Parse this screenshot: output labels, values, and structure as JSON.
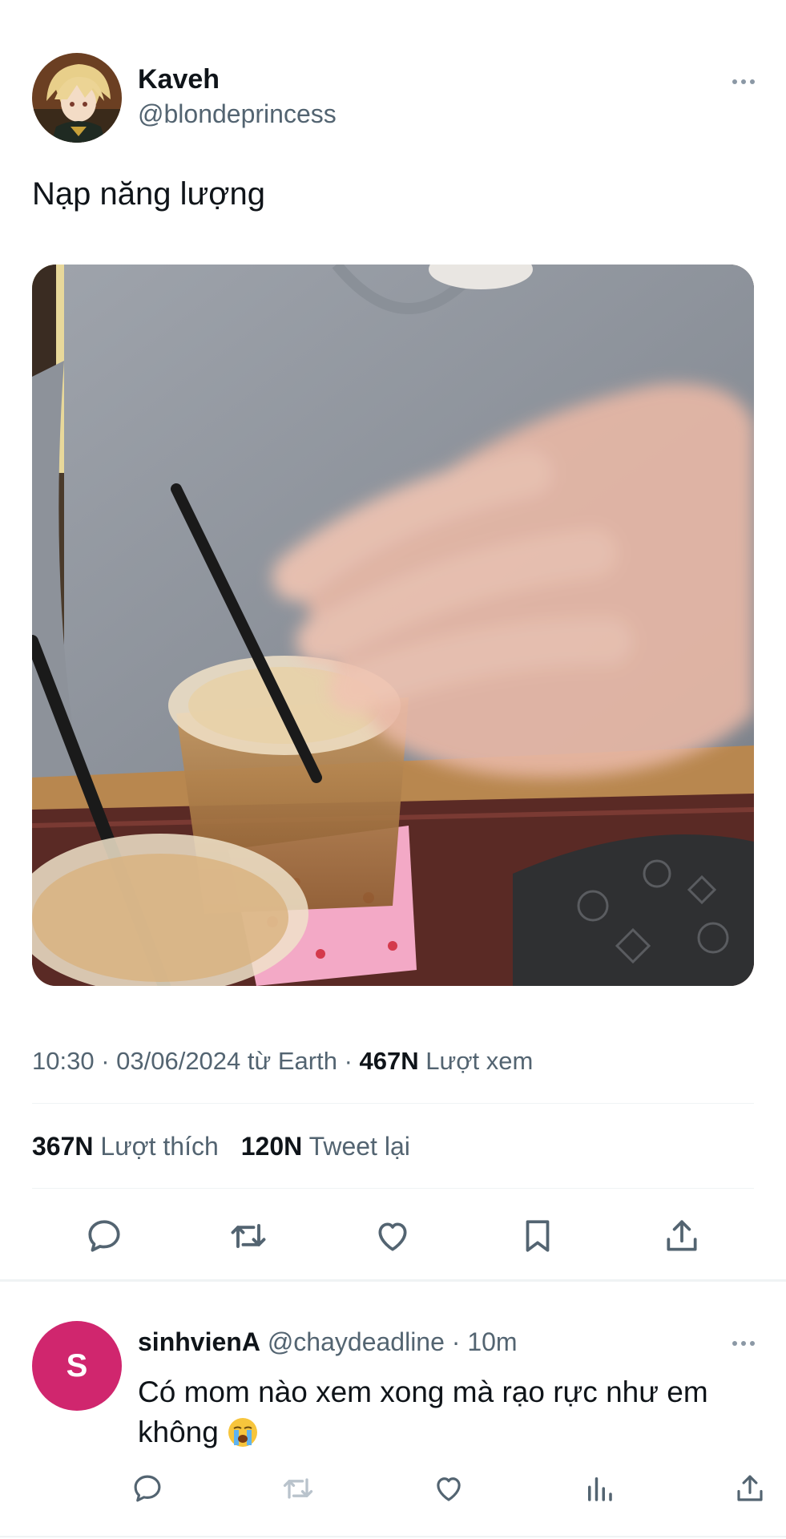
{
  "post": {
    "author_name": "Kaveh",
    "author_handle": "@blondeprincess",
    "text": "Nạp năng lượng",
    "time": "10:30 · 03/06/2024 từ Earth · ",
    "views_count": "467N",
    "views_label": " Lượt xem",
    "likes_count": "367N",
    "likes_label": " Lượt thích",
    "retweets_count": "120N",
    "retweets_label": " Tweet lại"
  },
  "actions": {
    "icons": [
      "reply-icon",
      "retweet-icon",
      "like-icon",
      "bookmark-icon",
      "share-icon"
    ]
  },
  "reply": {
    "avatar_letter": "S",
    "avatar_color": "#d0266e",
    "name": "sinhvienA",
    "handle": "@chaydeadline",
    "time": " · 10m",
    "text": "Có mom nào xem xong mà rạo rực như em không",
    "emoji": "😭",
    "icons": [
      "reply-icon",
      "retweet-icon",
      "like-icon",
      "analytics-icon",
      "share-icon"
    ]
  },
  "colors": {
    "text_primary": "#0f1419",
    "text_secondary": "#536471",
    "divider": "#eff3f4"
  }
}
